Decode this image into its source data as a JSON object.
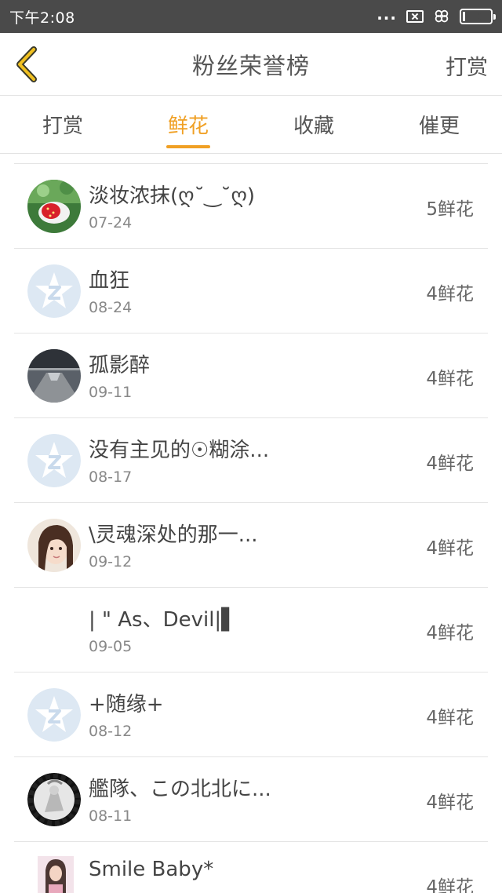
{
  "status_bar": {
    "time": "下午2:08",
    "dots": "...",
    "battery_level": "10",
    "battery_fraction": 0.1
  },
  "header": {
    "title": "粉丝荣誉榜",
    "right_action": "打赏",
    "back_icon": "chevron-left-icon"
  },
  "tabs": [
    {
      "label": "打赏",
      "active": false
    },
    {
      "label": "鲜花",
      "active": true
    },
    {
      "label": "收藏",
      "active": false
    },
    {
      "label": "催更",
      "active": false
    }
  ],
  "accent_color": "#f0a024",
  "rows": [
    {
      "name": "淡妆浓抹(ღ˘‿˘ღ)",
      "date": "07-24",
      "flowers": "5鲜花",
      "avatar": "strawberry-photo"
    },
    {
      "name": "血狂",
      "date": "08-24",
      "flowers": "4鲜花",
      "avatar": "default-qq-avatar"
    },
    {
      "name": "孤影醉",
      "date": "09-11",
      "flowers": "4鲜花",
      "avatar": "tunnel-photo"
    },
    {
      "name": "没有主见的☉糊涂...",
      "date": "08-17",
      "flowers": "4鲜花",
      "avatar": "default-qq-avatar"
    },
    {
      "name": "\\灵魂深处的那一...",
      "date": "09-12",
      "flowers": "4鲜花",
      "avatar": "girl-portrait-photo"
    },
    {
      "name": "| \" As、Devil|▌",
      "date": "09-05",
      "flowers": "4鲜花",
      "avatar": "none"
    },
    {
      "name": "+随缘+",
      "date": "08-12",
      "flowers": "4鲜花",
      "avatar": "default-qq-avatar"
    },
    {
      "name": "艦隊、この北北に...",
      "date": "08-11",
      "flowers": "4鲜花",
      "avatar": "anime-figure-photo"
    },
    {
      "name": "Smile Baby*",
      "date": "",
      "flowers": "4鲜花",
      "avatar": "woman-photo"
    }
  ]
}
